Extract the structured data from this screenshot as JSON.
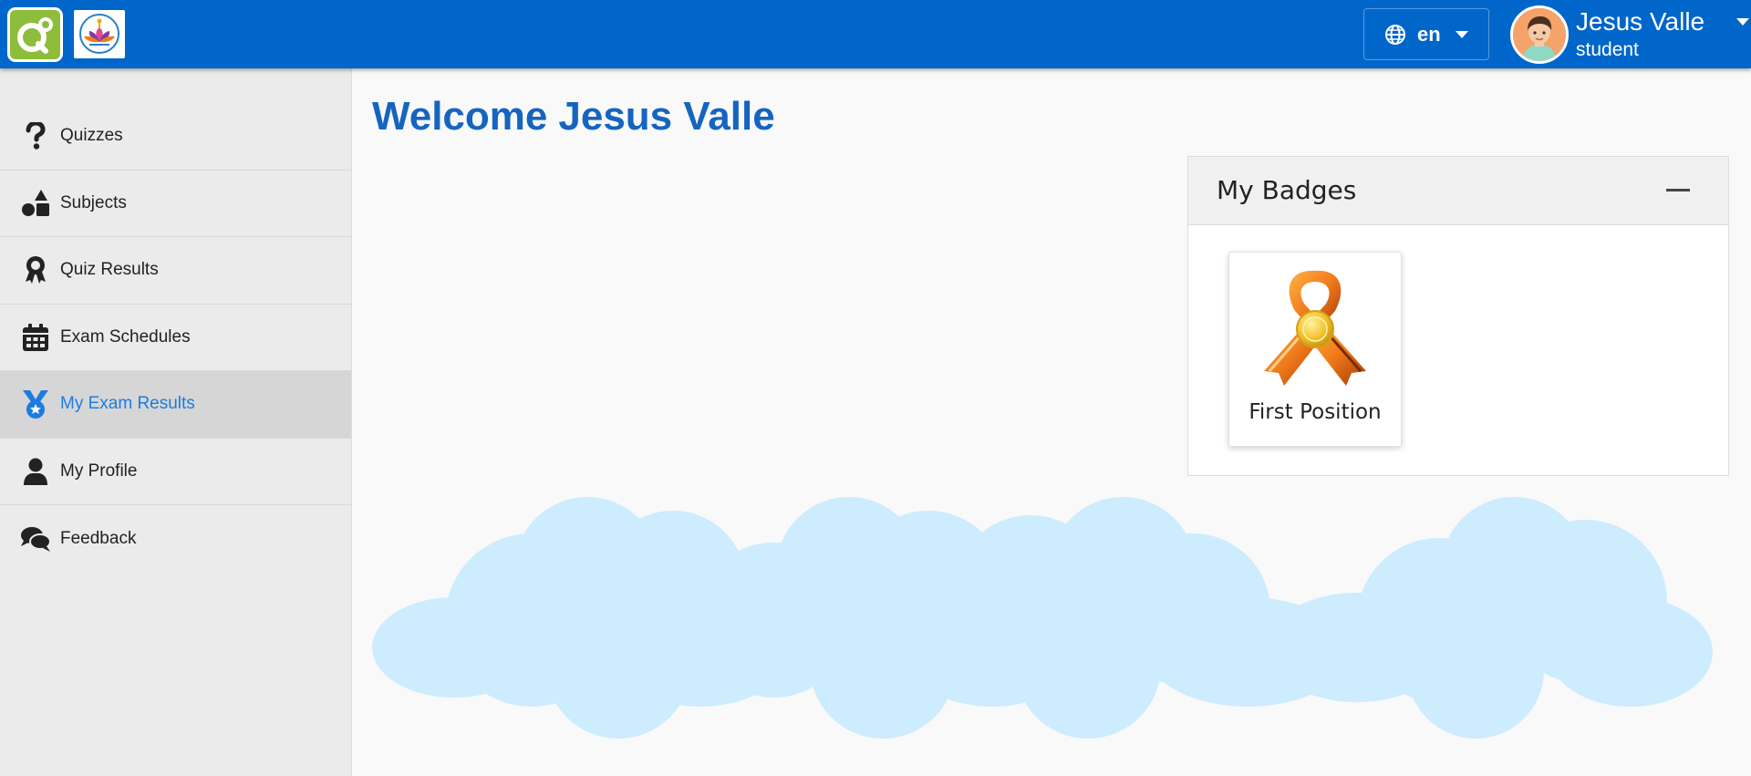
{
  "header": {
    "language": {
      "label": "en",
      "icon": "globe-icon"
    },
    "user": {
      "name": "Jesus Valle",
      "role": "student",
      "icon": "avatar"
    }
  },
  "sidebar": {
    "items": [
      {
        "label": "Quizzes",
        "icon": "question-icon",
        "active": false
      },
      {
        "label": "Subjects",
        "icon": "shapes-icon",
        "active": false
      },
      {
        "label": "Quiz Results",
        "icon": "award-icon",
        "active": false
      },
      {
        "label": "Exam Schedules",
        "icon": "calendar-icon",
        "active": false
      },
      {
        "label": "My Exam Results",
        "icon": "medal-icon",
        "active": true
      },
      {
        "label": "My Profile",
        "icon": "user-icon",
        "active": false
      },
      {
        "label": "Feedback",
        "icon": "comments-icon",
        "active": false
      }
    ]
  },
  "main": {
    "welcome_prefix": "Welcome",
    "welcome_name": "Jesus Valle",
    "badges": {
      "title": "My Badges",
      "items": [
        {
          "label": "First Position",
          "icon": "ribbon-medal-icon"
        }
      ]
    }
  },
  "colors": {
    "topbar": "#0066c9",
    "accent": "#1c7ce0",
    "title": "#1565c0",
    "sidebar_bg": "#ebebeb",
    "cloud": "#cdecfd"
  }
}
